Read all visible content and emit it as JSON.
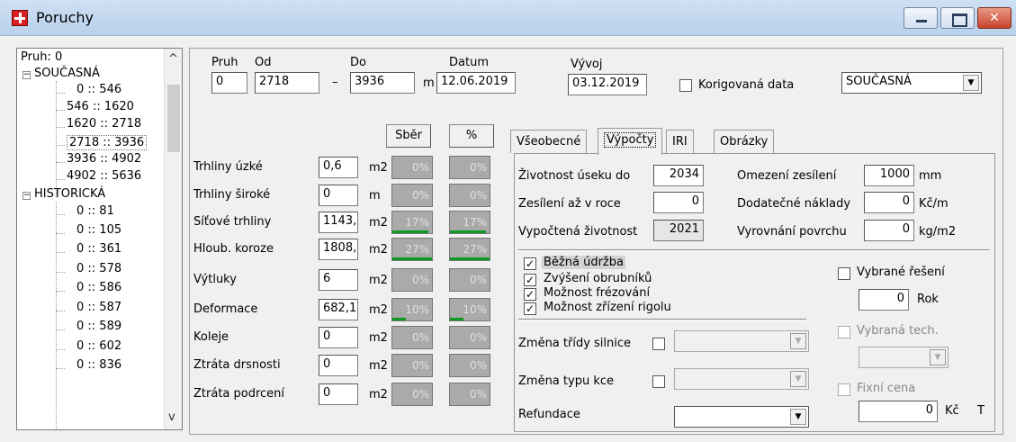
{
  "window": {
    "title": "Poruchy"
  },
  "tree": {
    "header": "Pruh: 0",
    "groups": [
      {
        "label": "SOUČASNÁ",
        "items": [
          "0 :: 546",
          "546 :: 1620",
          "1620 :: 2718",
          "2718 :: 3936",
          "3936 :: 4902",
          "4902 :: 5636"
        ]
      },
      {
        "label": "HISTORICKÁ",
        "items": [
          "0 :: 81",
          "0 :: 105",
          "0 :: 361",
          "0 :: 578",
          "0 :: 586",
          "0 :: 587",
          "0 :: 589",
          "0 :: 602",
          "0 :: 836"
        ]
      }
    ]
  },
  "header": {
    "pruh_label": "Pruh",
    "pruh_value": "0",
    "od_label": "Od",
    "od_value": "2718",
    "dash": "–",
    "do_label": "Do",
    "do_value": "3936",
    "unit_m": "m",
    "datum_label": "Datum",
    "datum_value": "12.06.2019",
    "vyvoj_label": "Vývoj",
    "vyvoj_value": "03.12.2019",
    "korigovana_label": "Korigovaná data",
    "mode_value": "SOUČASNÁ"
  },
  "defects": {
    "col_sber": "Sběr",
    "col_pct": "%",
    "rows": [
      {
        "label": "Trhliny úzké",
        "value": "0,6",
        "unit": "m2",
        "sber": "0%",
        "pct": "0%",
        "fill": 0.0
      },
      {
        "label": "Trhliny široké",
        "value": "0",
        "unit": "m",
        "sber": "0%",
        "pct": "0%",
        "fill": 0.0
      },
      {
        "label": "Síťové trhliny",
        "value": "1143,",
        "unit": "m2",
        "sber": "17%",
        "pct": "17%",
        "fill": 0.9
      },
      {
        "label": "Hloub. koroze",
        "value": "1808,",
        "unit": "m2",
        "sber": "27%",
        "pct": "27%",
        "fill": 1.0
      },
      {
        "label": "Výtluky",
        "value": "6",
        "unit": "m2",
        "sber": "0%",
        "pct": "0%",
        "fill": 0.0
      },
      {
        "label": "Deformace",
        "value": "682,1",
        "unit": "m2",
        "sber": "10%",
        "pct": "10%",
        "fill": 0.35
      },
      {
        "label": "Koleje",
        "value": "0",
        "unit": "m2",
        "sber": "0%",
        "pct": "0%",
        "fill": 0.0
      },
      {
        "label": "Ztráta drsnosti",
        "value": "0",
        "unit": "m2",
        "sber": "0%",
        "pct": "0%",
        "fill": 0.0
      },
      {
        "label": "Ztráta podrcení",
        "value": "0",
        "unit": "m2",
        "sber": "0%",
        "pct": "0%",
        "fill": 0.0
      }
    ]
  },
  "tabs": [
    "Všeobecné",
    "Výpočty",
    "IRI",
    "Obrázky"
  ],
  "calc": {
    "zivotnost_label": "Životnost úseku do",
    "zivotnost_value": "2034",
    "omezeni_label": "Omezení zesílení",
    "omezeni_value": "1000",
    "omezeni_unit": "mm",
    "zesileni_label": "Zesílení až v roce",
    "zesileni_value": "0",
    "dodatecne_label": "Dodatečné náklady",
    "dodatecne_value": "0",
    "dodatecne_unit": "Kč/m",
    "vypoctena_label": "Vypočtená životnost",
    "vypoctena_value": "2021",
    "vyrovnani_label": "Vyrovnání povrchu",
    "vyrovnani_value": "0",
    "vyrovnani_unit": "kg/m2",
    "checks": [
      "Běžná údržba",
      "Zvýšení obrubníků",
      "Možnost frézování",
      "Možnost zřízení rigolu"
    ],
    "vybrane_reseni_label": "Vybrané řešení",
    "rok_value": "0",
    "rok_label": "Rok",
    "vybrana_tech_label": "Vybraná tech.",
    "zmena_tridy_label": "Změna třídy silnice",
    "zmena_typu_label": "Změna typu kce",
    "refundace_label": "Refundace",
    "fixni_cena_label": "Fixní cena",
    "fixni_value": "0",
    "fixni_unit": "Kč",
    "fixni_trailing": "T"
  }
}
